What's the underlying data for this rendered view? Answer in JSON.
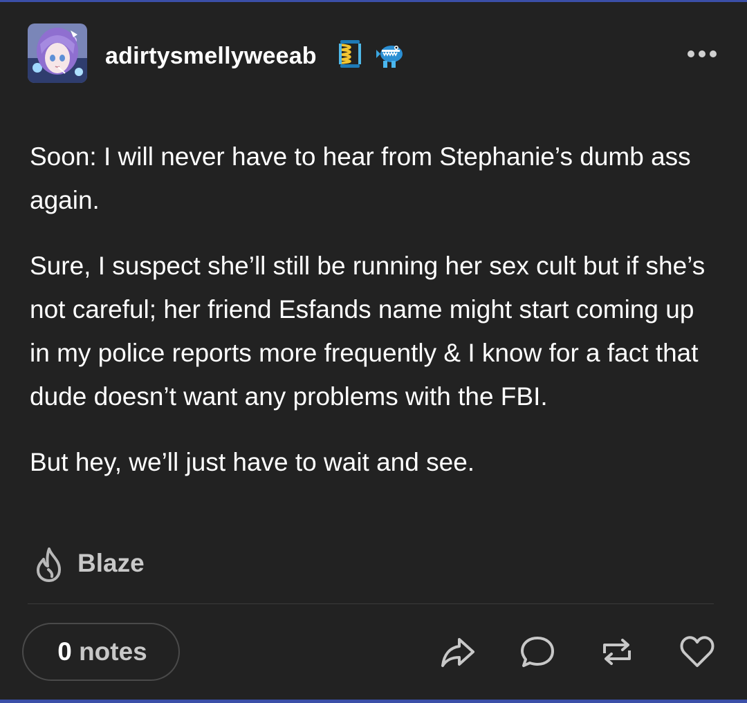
{
  "post": {
    "author": "adirtysmellyweeab",
    "paragraphs": [
      "Soon: I will never have to hear from Stephanie’s dumb ass again.",
      "Sure, I suspect she’ll still be running her sex cult but if she’s not careful; her friend Esfands name might start coming up in my police reports more frequently & I know for a fact that dude doesn’t want any problems with the FBI.",
      "But hey, we’ll just have to wait and see."
    ],
    "blaze_label": "Blaze"
  },
  "footer": {
    "notes_count": "0",
    "notes_label": "notes"
  },
  "icons": {
    "avatar": "anime-avatar",
    "badge_1": "spring-badge-icon",
    "badge_2": "fish-badge-icon",
    "more": "more-dots-icon",
    "blaze": "flame-icon",
    "share": "share-arrow-icon",
    "reply": "reply-bubble-icon",
    "reblog": "reblog-icon",
    "like": "heart-icon"
  },
  "colors": {
    "background": "#222222",
    "text": "#ffffff",
    "muted": "#c8c8c8",
    "accent_edge": "#3b4fa8"
  }
}
